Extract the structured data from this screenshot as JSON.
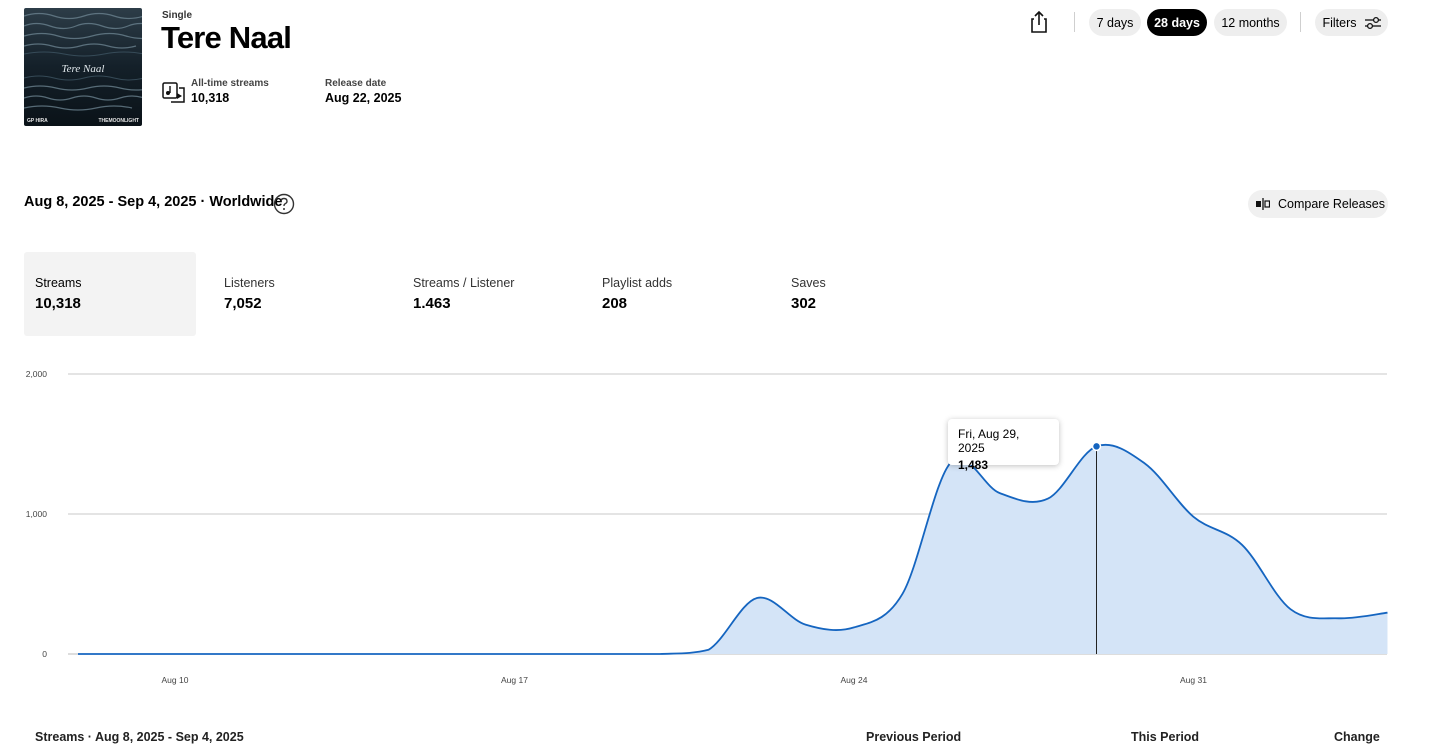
{
  "release": {
    "type_label": "Single",
    "title": "Tere Naal",
    "cover_text": "Tere Naal",
    "cover_artist": "GP HIRA",
    "cover_label": "THEMOONLIGHT",
    "alltime_label": "All-time streams",
    "alltime_value": "10,318",
    "release_label": "Release date",
    "release_value": "Aug 22, 2025"
  },
  "toolbar": {
    "share_icon": "share-icon",
    "ranges": [
      "7 days",
      "28 days",
      "12 months"
    ],
    "active_range": "28 days",
    "filters_label": "Filters"
  },
  "section": {
    "range_title": "Aug 8, 2025 - Sep 4, 2025 · Worldwide",
    "help_icon": "question-circle-icon",
    "compare_label": "Compare Releases"
  },
  "metrics": [
    {
      "label": "Streams",
      "value": "10,318"
    },
    {
      "label": "Listeners",
      "value": "7,052"
    },
    {
      "label": "Streams / Listener",
      "value": "1.463"
    },
    {
      "label": "Playlist adds",
      "value": "208"
    },
    {
      "label": "Saves",
      "value": "302"
    }
  ],
  "tooltip": {
    "date": "Fri, Aug 29, 2025",
    "value": "1,483"
  },
  "table_header": {
    "title": "Streams · Aug 8, 2025 - Sep 4, 2025",
    "previous": "Previous Period",
    "current": "This Period",
    "change": "Change"
  },
  "chart_data": {
    "type": "area",
    "title": "",
    "xlabel": "",
    "ylabel": "",
    "ylim": [
      0,
      2000
    ],
    "y_ticks": [
      "0",
      "1,000",
      "2,000"
    ],
    "x_ticks": [
      "Aug 10",
      "Aug 17",
      "Aug 24",
      "Aug 31"
    ],
    "grid": true,
    "series": [
      {
        "values": [
          {
            "x": "2025-08-08",
            "y": 0
          },
          {
            "x": "2025-08-09",
            "y": 0
          },
          {
            "x": "2025-08-10",
            "y": 0
          },
          {
            "x": "2025-08-11",
            "y": 0
          },
          {
            "x": "2025-08-12",
            "y": 0
          },
          {
            "x": "2025-08-13",
            "y": 0
          },
          {
            "x": "2025-08-14",
            "y": 0
          },
          {
            "x": "2025-08-15",
            "y": 0
          },
          {
            "x": "2025-08-16",
            "y": 0
          },
          {
            "x": "2025-08-17",
            "y": 0
          },
          {
            "x": "2025-08-18",
            "y": 0
          },
          {
            "x": "2025-08-19",
            "y": 0
          },
          {
            "x": "2025-08-20",
            "y": 0
          },
          {
            "x": "2025-08-21",
            "y": 30
          },
          {
            "x": "2025-08-22",
            "y": 400
          },
          {
            "x": "2025-08-23",
            "y": 210
          },
          {
            "x": "2025-08-24",
            "y": 190
          },
          {
            "x": "2025-08-25",
            "y": 430
          },
          {
            "x": "2025-08-26",
            "y": 1370
          },
          {
            "x": "2025-08-27",
            "y": 1150
          },
          {
            "x": "2025-08-28",
            "y": 1110
          },
          {
            "x": "2025-08-29",
            "y": 1483
          },
          {
            "x": "2025-08-30",
            "y": 1360
          },
          {
            "x": "2025-08-31",
            "y": 980
          },
          {
            "x": "2025-09-01",
            "y": 780
          },
          {
            "x": "2025-09-02",
            "y": 320
          },
          {
            "x": "2025-09-03",
            "y": 255
          },
          {
            "x": "2025-09-04",
            "y": 295
          }
        ]
      }
    ],
    "highlight": {
      "x": "2025-08-29",
      "y": 1483
    },
    "line_color": "#1565c0",
    "fill_color": "#d4e4f7"
  }
}
